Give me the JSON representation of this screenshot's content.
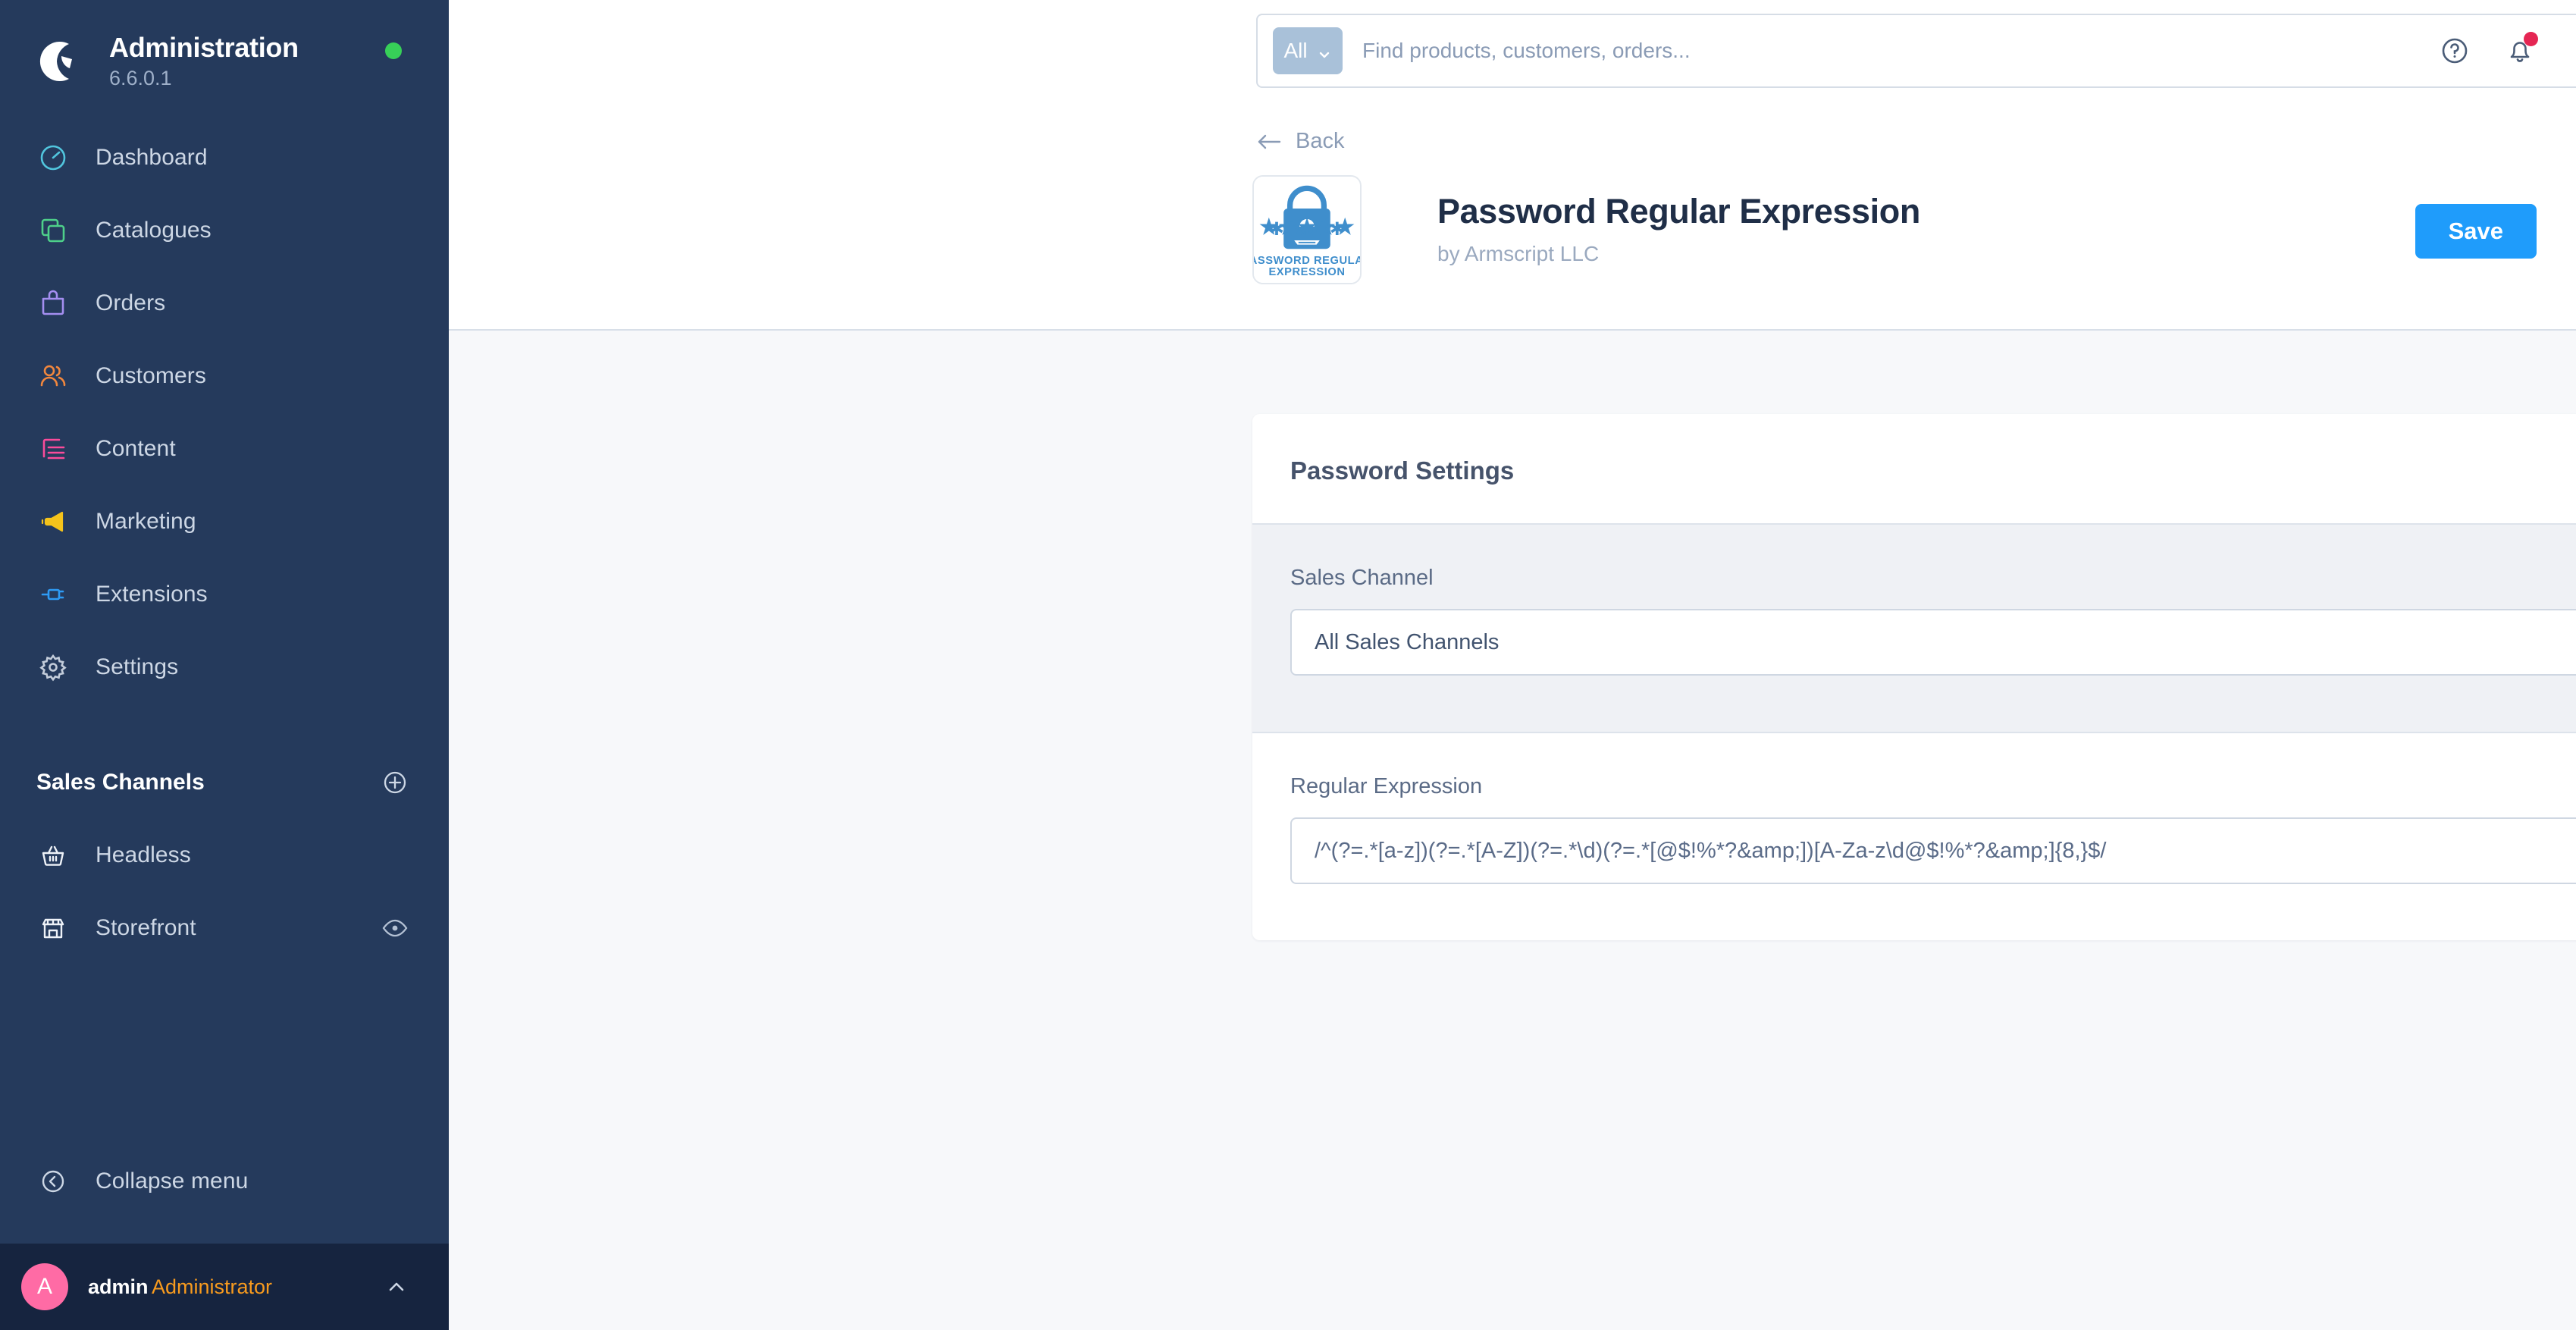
{
  "sidebar": {
    "brand": {
      "title": "Administration",
      "version": "6.6.0.1",
      "status": "online",
      "status_color": "#37d058"
    },
    "nav": [
      {
        "label": "Dashboard",
        "icon": "dashboard-icon",
        "color": "#51c5dd"
      },
      {
        "label": "Catalogues",
        "icon": "catalogues-icon",
        "color": "#4ed08a"
      },
      {
        "label": "Orders",
        "icon": "orders-icon",
        "color": "#a48ef0"
      },
      {
        "label": "Customers",
        "icon": "customers-icon",
        "color": "#f2873d"
      },
      {
        "label": "Content",
        "icon": "content-icon",
        "color": "#fa4b9a"
      },
      {
        "label": "Marketing",
        "icon": "marketing-icon",
        "color": "#f5c31b"
      },
      {
        "label": "Extensions",
        "icon": "extensions-icon",
        "color": "#2e9bf5"
      },
      {
        "label": "Settings",
        "icon": "settings-icon",
        "color": "#c3ccda"
      }
    ],
    "sales_channels": {
      "title": "Sales Channels",
      "add_label": "plus-circle-icon",
      "items": [
        {
          "label": "Headless",
          "icon": "basket-icon"
        },
        {
          "label": "Storefront",
          "icon": "storefront-icon",
          "action_icon": "eye-icon"
        }
      ]
    },
    "collapse": {
      "label": "Collapse menu",
      "icon": "chevron-left-circle-icon"
    },
    "user": {
      "initial": "A",
      "name": "admin",
      "role": "Administrator",
      "chevron": "chevron-up-icon"
    }
  },
  "topbar": {
    "search": {
      "scope": "All",
      "placeholder": "Find products, customers, orders...",
      "value": ""
    },
    "help_icon": "question-circle-icon",
    "notifications_icon": "bell-icon",
    "notifications_badge_color": "#e52653"
  },
  "page": {
    "back_label": "Back",
    "title": "Password Regular Expression",
    "subtitle": "by Armscript LLC",
    "save_label": "Save",
    "app_icon": {
      "name": "password-regular-expression-logo",
      "line1": "PASSWORD REGULAR",
      "line2": "EXPRESSION",
      "brand_color": "#3f8ecc"
    }
  },
  "card": {
    "title": "Password Settings",
    "sales_channel": {
      "label": "Sales Channel",
      "value": "All Sales Channels"
    },
    "regular_expression": {
      "label": "Regular Expression",
      "value": "/^(?=.*[a-z])(?=.*[A-Z])(?=.*\\d)(?=.*[@$!%*?&amp;])[A-Za-z\\d@$!%*?&amp;]{8,}$/"
    }
  }
}
